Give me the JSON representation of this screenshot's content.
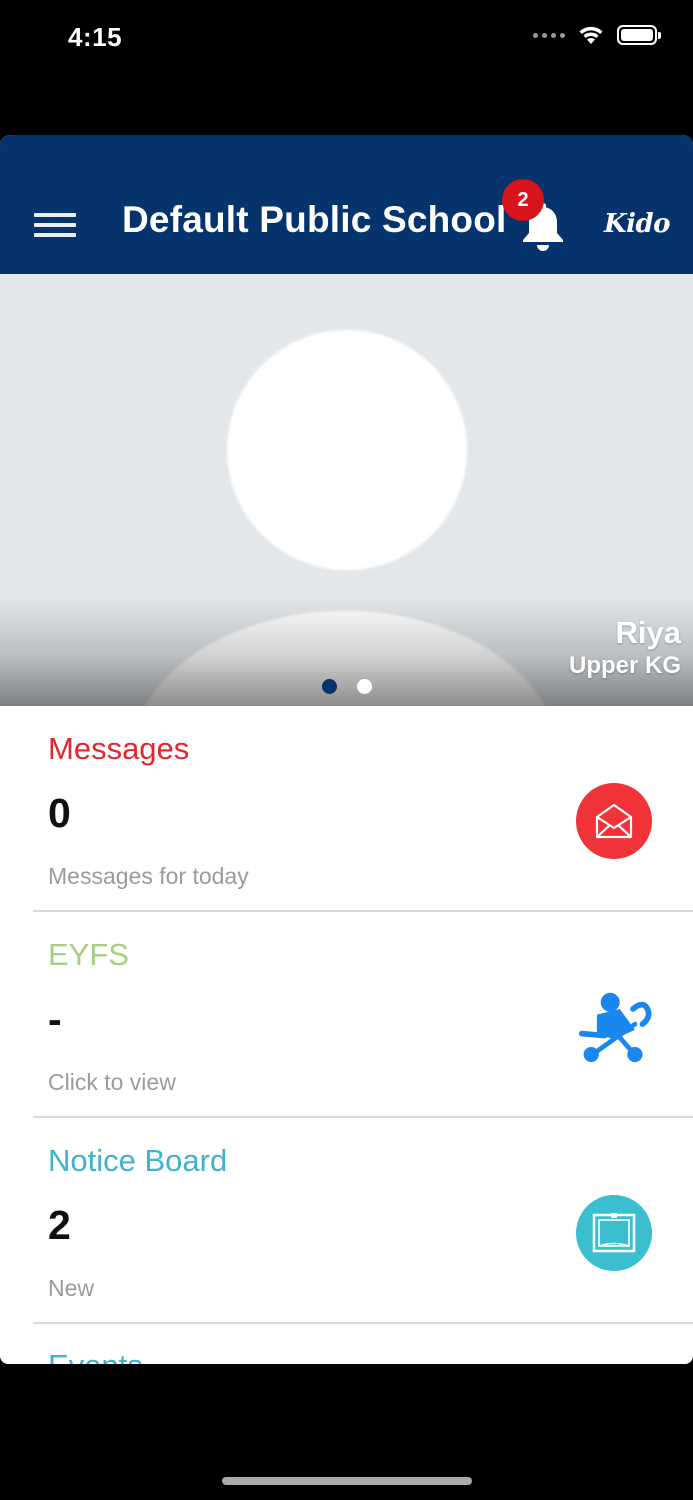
{
  "status_bar": {
    "time": "4:15"
  },
  "header": {
    "title": "Default Public School",
    "notification_count": "2",
    "brand": "Kido",
    "bg_color": "#05346c"
  },
  "profile": {
    "name": "Riya",
    "class": "Upper KG",
    "carousel": {
      "pages": 2,
      "active_index": 0
    }
  },
  "cards": [
    {
      "title": "Messages",
      "value": "0",
      "subtitle": "Messages for today",
      "title_color": "#e2282e",
      "icon": "envelope-icon",
      "icon_bg": "#ef3338"
    },
    {
      "title": "EYFS",
      "value": "-",
      "subtitle": "Click to view",
      "title_color": "#a6cf7f",
      "icon": "stroller-icon",
      "icon_bg": "#1a86f0"
    },
    {
      "title": "Notice Board",
      "value": "2",
      "subtitle": "New",
      "title_color": "#42b1cd",
      "icon": "notice-board-icon",
      "icon_bg": "#3bbfcf"
    },
    {
      "title": "Events",
      "title_color": "#42b1cd"
    }
  ]
}
